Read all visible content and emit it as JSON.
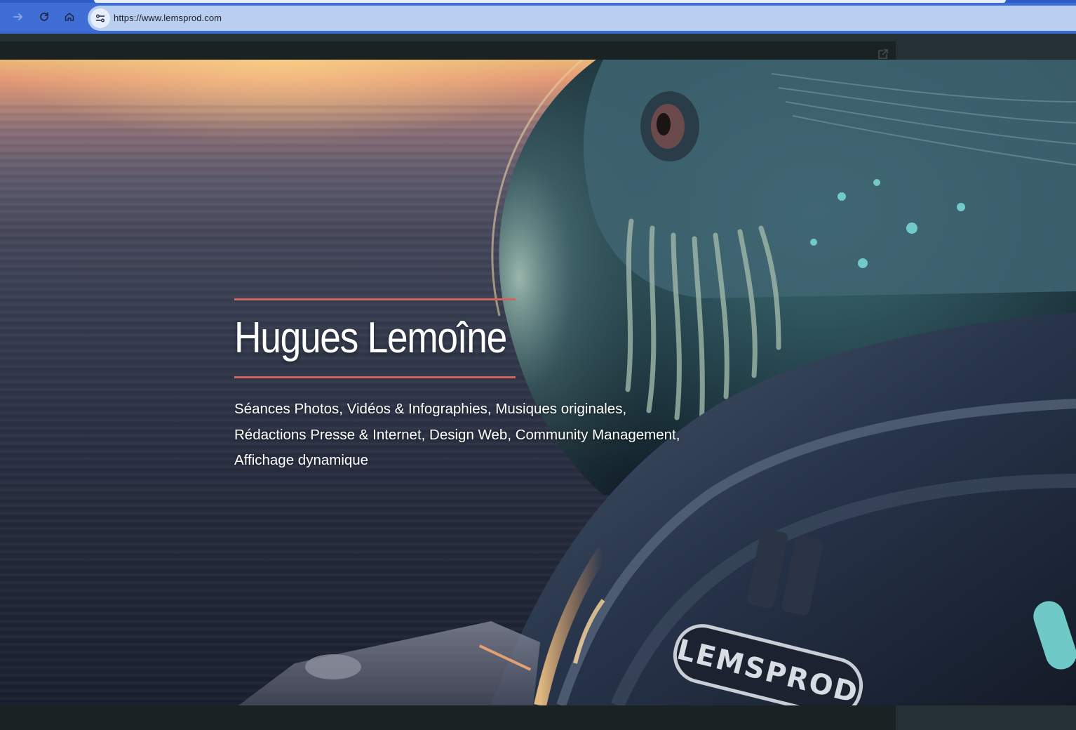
{
  "browser": {
    "url": "https://www.lemsprod.com",
    "icons": {
      "forward": "arrow-right-icon",
      "reload": "reload-icon",
      "home": "home-icon",
      "site_info": "tune-icon"
    }
  },
  "hero": {
    "title": "Hugues Lemoîne",
    "subtitle_lines": [
      "Séances Photos, Vidéos & Infographies, Musiques originales,",
      "Rédactions Presse & Internet, Design Web, Community Management,",
      "Affichage dynamique"
    ],
    "badge_text": "LEMSPROD",
    "accent_color": "#d2625c"
  }
}
